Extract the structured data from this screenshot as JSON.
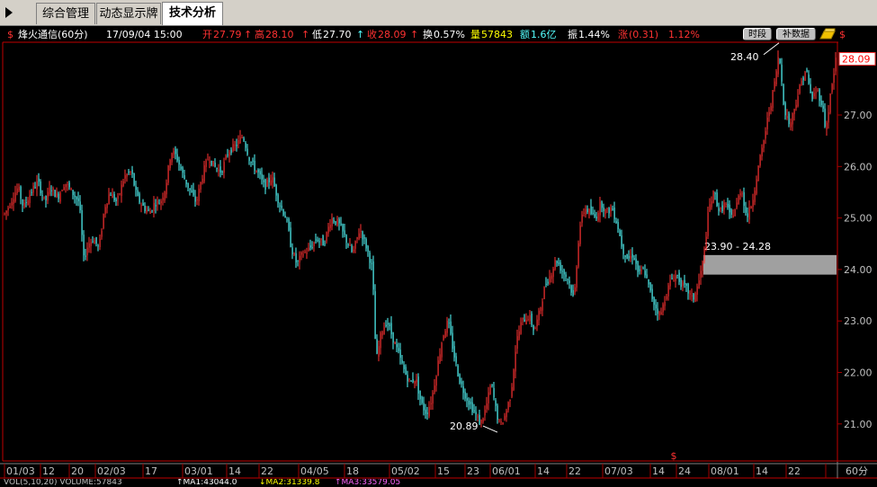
{
  "tabs": [
    "综合管理",
    "动态显示牌",
    "技术分析"
  ],
  "active_tab": "技术分析",
  "stock": {
    "name": "烽火通信(60分)",
    "datetime": "17/09/04 15:00",
    "open_label": "开",
    "open": "27.79",
    "high_label": "高",
    "high": "28.10",
    "low_label": "低",
    "low": "27.70",
    "close_label": "收",
    "close": "28.09",
    "turnover_label": "换",
    "turnover": "0.57%",
    "volume_label": "量",
    "volume": "57843",
    "amount_label": "额",
    "amount": "1.6亿",
    "amplitude_label": "振",
    "amplitude": "1.44%",
    "change_label": "涨",
    "change": "(0.31)",
    "change_pct": "1.12%"
  },
  "buttons": {
    "period": "时段",
    "fill_data": "补数据"
  },
  "price_axis": [
    "28.09",
    "27.00",
    "26.00",
    "25.00",
    "24.00",
    "23.00",
    "22.00",
    "21.00"
  ],
  "date_axis": [
    {
      "label": "01/03",
      "key": true
    },
    {
      "label": "12"
    },
    {
      "label": "20"
    },
    {
      "label": "02/03",
      "key": true
    },
    {
      "label": "17"
    },
    {
      "label": "03/01",
      "key": true
    },
    {
      "label": "14"
    },
    {
      "label": "22"
    },
    {
      "label": "04/05",
      "key": true
    },
    {
      "label": "18"
    },
    {
      "label": "05/02",
      "key": true
    },
    {
      "label": "15"
    },
    {
      "label": "23"
    },
    {
      "label": "06/01",
      "key": true
    },
    {
      "label": "14"
    },
    {
      "label": "22"
    },
    {
      "label": "07/03",
      "key": true
    },
    {
      "label": "14"
    },
    {
      "label": "24"
    },
    {
      "label": "08/01",
      "key": true
    },
    {
      "label": "14"
    },
    {
      "label": "22"
    }
  ],
  "period_label": "60分",
  "annotations": {
    "high_mark": "28.40",
    "low_mark": "20.89",
    "gap_range": "23.90 - 24.28"
  },
  "status_bar": [
    "VOL(5,10,20) VOLUME:57843",
    "↑MA1:43044.0",
    "↓MA2:31339.8",
    "↑MA3:33579.05"
  ],
  "colors": {
    "up": "#ff3232",
    "down": "#54ffff",
    "grid": "#a00000",
    "axis_text": "#c0c0c0"
  },
  "chart_data": {
    "type": "candlestick",
    "y_range": [
      20.75,
      28.6
    ],
    "price_ticks": [
      27.0,
      26.0,
      25.0,
      24.0,
      23.0,
      22.0,
      21.0
    ],
    "last_price": 28.09,
    "high_point": 28.4,
    "low_point": 20.89,
    "gap_zone": [
      23.9,
      24.28
    ],
    "path": [
      [
        0,
        25.0
      ],
      [
        6,
        25.1
      ],
      [
        14,
        25.4
      ],
      [
        20,
        25.6
      ],
      [
        26,
        25.2
      ],
      [
        34,
        25.5
      ],
      [
        42,
        25.7
      ],
      [
        50,
        25.3
      ],
      [
        56,
        25.6
      ],
      [
        64,
        25.4
      ],
      [
        72,
        25.7
      ],
      [
        80,
        25.5
      ],
      [
        88,
        25.3
      ],
      [
        93,
        24.2
      ],
      [
        98,
        24.5
      ],
      [
        104,
        24.6
      ],
      [
        110,
        24.4
      ],
      [
        116,
        25.2
      ],
      [
        122,
        25.5
      ],
      [
        130,
        25.3
      ],
      [
        138,
        25.8
      ],
      [
        146,
        25.9
      ],
      [
        152,
        25.4
      ],
      [
        160,
        25.2
      ],
      [
        166,
        25.1
      ],
      [
        172,
        25.3
      ],
      [
        178,
        25.3
      ],
      [
        184,
        25.6
      ],
      [
        190,
        26.3
      ],
      [
        196,
        26.2
      ],
      [
        204,
        25.8
      ],
      [
        212,
        25.5
      ],
      [
        218,
        25.3
      ],
      [
        226,
        25.9
      ],
      [
        232,
        26.2
      ],
      [
        238,
        26.0
      ],
      [
        246,
        25.9
      ],
      [
        254,
        26.3
      ],
      [
        262,
        26.4
      ],
      [
        270,
        26.6
      ],
      [
        278,
        26.1
      ],
      [
        286,
        25.9
      ],
      [
        294,
        25.6
      ],
      [
        302,
        25.8
      ],
      [
        310,
        25.3
      ],
      [
        318,
        25.0
      ],
      [
        324,
        24.4
      ],
      [
        330,
        24.1
      ],
      [
        336,
        24.3
      ],
      [
        344,
        24.4
      ],
      [
        352,
        24.6
      ],
      [
        360,
        24.5
      ],
      [
        368,
        25.0
      ],
      [
        376,
        24.9
      ],
      [
        384,
        24.6
      ],
      [
        392,
        24.3
      ],
      [
        400,
        24.8
      ],
      [
        408,
        24.4
      ],
      [
        414,
        24.0
      ],
      [
        418,
        22.2
      ],
      [
        424,
        22.8
      ],
      [
        430,
        23.0
      ],
      [
        436,
        22.7
      ],
      [
        444,
        22.3
      ],
      [
        450,
        22.0
      ],
      [
        456,
        21.8
      ],
      [
        462,
        21.9
      ],
      [
        468,
        21.4
      ],
      [
        474,
        21.2
      ],
      [
        480,
        21.5
      ],
      [
        486,
        22.1
      ],
      [
        492,
        22.7
      ],
      [
        498,
        23.0
      ],
      [
        504,
        22.4
      ],
      [
        510,
        21.9
      ],
      [
        516,
        21.6
      ],
      [
        522,
        21.4
      ],
      [
        528,
        21.2
      ],
      [
        534,
        21.0
      ],
      [
        540,
        21.3
      ],
      [
        546,
        21.8
      ],
      [
        552,
        21.2
      ],
      [
        556,
        20.95
      ],
      [
        562,
        21.2
      ],
      [
        568,
        21.6
      ],
      [
        574,
        22.6
      ],
      [
        580,
        23.0
      ],
      [
        588,
        23.1
      ],
      [
        594,
        22.8
      ],
      [
        600,
        23.2
      ],
      [
        606,
        23.7
      ],
      [
        612,
        23.9
      ],
      [
        618,
        24.2
      ],
      [
        624,
        24.0
      ],
      [
        632,
        23.8
      ],
      [
        638,
        23.4
      ],
      [
        644,
        24.8
      ],
      [
        650,
        25.2
      ],
      [
        656,
        25.1
      ],
      [
        662,
        25.0
      ],
      [
        668,
        25.3
      ],
      [
        674,
        25.1
      ],
      [
        680,
        25.2
      ],
      [
        686,
        24.9
      ],
      [
        692,
        24.4
      ],
      [
        698,
        24.2
      ],
      [
        704,
        24.3
      ],
      [
        710,
        23.9
      ],
      [
        716,
        24.0
      ],
      [
        722,
        23.6
      ],
      [
        728,
        23.3
      ],
      [
        734,
        23.1
      ],
      [
        740,
        23.5
      ],
      [
        746,
        23.8
      ],
      [
        752,
        23.9
      ],
      [
        758,
        23.7
      ],
      [
        764,
        23.6
      ],
      [
        770,
        23.4
      ],
      [
        776,
        23.7
      ],
      [
        782,
        24.2
      ],
      [
        788,
        25.2
      ],
      [
        794,
        25.5
      ],
      [
        800,
        25.1
      ],
      [
        806,
        25.3
      ],
      [
        812,
        25.0
      ],
      [
        818,
        25.2
      ],
      [
        824,
        25.6
      ],
      [
        830,
        25.0
      ],
      [
        836,
        25.3
      ],
      [
        842,
        25.9
      ],
      [
        848,
        26.4
      ],
      [
        854,
        27.0
      ],
      [
        860,
        27.5
      ],
      [
        866,
        28.2
      ],
      [
        872,
        27.1
      ],
      [
        878,
        26.8
      ],
      [
        884,
        27.2
      ],
      [
        890,
        27.6
      ],
      [
        896,
        27.9
      ],
      [
        902,
        27.3
      ],
      [
        908,
        27.5
      ],
      [
        914,
        27.2
      ],
      [
        918,
        26.7
      ],
      [
        924,
        27.5
      ],
      [
        930,
        28.09
      ]
    ]
  }
}
